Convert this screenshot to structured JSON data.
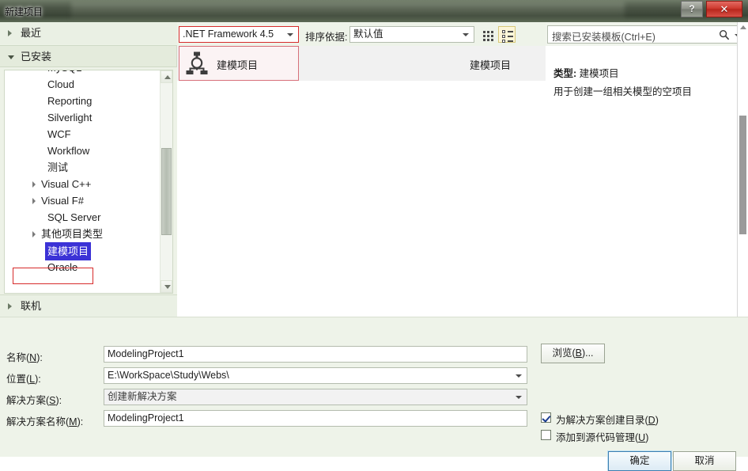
{
  "window": {
    "title": "新建项目",
    "help_label": "?",
    "close_label": "✕"
  },
  "sidebar": {
    "recent": {
      "label": "最近",
      "expanded": false
    },
    "installed": {
      "label": "已安装",
      "expanded": true
    },
    "online": {
      "label": "联机",
      "expanded": false
    },
    "tree_items": [
      {
        "label": "MySQL",
        "type": "leaf",
        "selected": false
      },
      {
        "label": "Cloud",
        "type": "leaf",
        "selected": false
      },
      {
        "label": "Reporting",
        "type": "leaf",
        "selected": false
      },
      {
        "label": "Silverlight",
        "type": "leaf",
        "selected": false
      },
      {
        "label": "WCF",
        "type": "leaf",
        "selected": false
      },
      {
        "label": "Workflow",
        "type": "leaf",
        "selected": false
      },
      {
        "label": "测试",
        "type": "leaf",
        "selected": false
      },
      {
        "label": "Visual C++",
        "type": "node",
        "selected": false
      },
      {
        "label": "Visual F#",
        "type": "node",
        "selected": false
      },
      {
        "label": "SQL Server",
        "type": "leaf",
        "selected": false
      },
      {
        "label": "其他项目类型",
        "type": "node",
        "selected": false
      },
      {
        "label": "建模项目",
        "type": "leaf",
        "selected": true
      },
      {
        "label": "Oracle",
        "type": "leaf",
        "selected": false
      }
    ]
  },
  "toolbar": {
    "framework": ".NET Framework 4.5",
    "sort_label": "排序依据:",
    "sort_value": "默认值",
    "view_grid_name": "medium-icons-view",
    "view_list_name": "small-icons-view"
  },
  "search": {
    "placeholder": "搜索已安装模板(Ctrl+E)",
    "value": "搜索已安装模板(Ctrl+E)"
  },
  "templates": [
    {
      "name": "建模项目",
      "type": "建模项目",
      "icon": "modeling-project-icon",
      "selected": true
    }
  ],
  "details": {
    "type_label": "类型:",
    "type_value": "建模项目",
    "description": "用于创建一组相关模型的空项目"
  },
  "form": {
    "name_label_pre": "名称(",
    "name_label_key": "N",
    "name_label_post": "):",
    "name_value": "ModelingProject1",
    "location_label_pre": "位置(",
    "location_label_key": "L",
    "location_label_post": "):",
    "location_value": "E:\\WorkSpace\\Study\\Webs\\",
    "solution_label_pre": "解决方案(",
    "solution_label_key": "S",
    "solution_label_post": "):",
    "solution_value": "创建新解决方案",
    "solution_name_label_pre": "解决方案名称(",
    "solution_name_label_key": "M",
    "solution_name_label_post": "):",
    "solution_name_value": "ModelingProject1",
    "browse_pre": "浏览(",
    "browse_key": "B",
    "browse_post": ")...",
    "create_dir_pre": "为解决方案创建目录(",
    "create_dir_key": "D",
    "create_dir_post": ")",
    "create_dir_checked": true,
    "source_control_pre": "添加到源代码管理(",
    "source_control_key": "U",
    "source_control_post": ")",
    "source_control_checked": false
  },
  "buttons": {
    "ok": "确定",
    "cancel": "取消"
  },
  "colors": {
    "accent_red": "#d72b2b",
    "selection_blue": "#3b32d6",
    "panel_green": "#eef3e9",
    "close_red": "#cf3b30"
  }
}
